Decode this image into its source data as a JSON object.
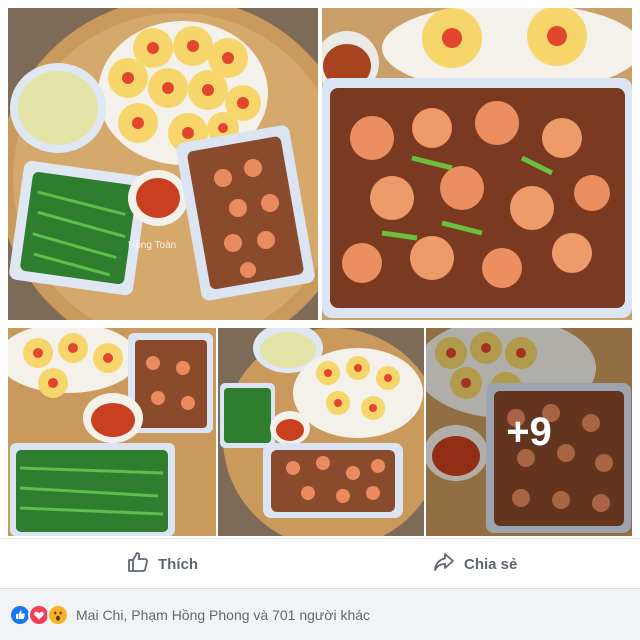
{
  "photos": {
    "watermark": "Hồng Toàn",
    "more_count": "+9"
  },
  "actions": {
    "like_label": "Thích",
    "share_label": "Chia sẻ"
  },
  "reactions": {
    "summary": "Mai Chi, Phạm Hồng Phong và 701 người khác",
    "icons": [
      "like-icon",
      "love-icon",
      "wow-icon"
    ]
  },
  "colors": {
    "action_text": "#606770",
    "reaction_bar_bg": "#f2f3f5",
    "like_blue": "#1877f2",
    "love_red": "#f33e58",
    "wow_yellow": "#f7b125"
  }
}
